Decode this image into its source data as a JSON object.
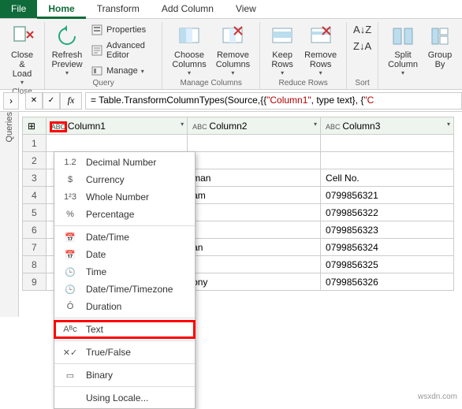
{
  "tabs": {
    "file": "File",
    "home": "Home",
    "transform": "Transform",
    "addcol": "Add Column",
    "view": "View"
  },
  "ribbon": {
    "close": {
      "close_load": "Close &\nLoad",
      "group": "Close"
    },
    "query": {
      "refresh": "Refresh\nPreview",
      "properties": "Properties",
      "advanced": "Advanced Editor",
      "manage": "Manage",
      "group": "Query"
    },
    "cols": {
      "choose": "Choose\nColumns",
      "remove": "Remove\nColumns",
      "group": "Manage Columns"
    },
    "rows": {
      "keep": "Keep\nRows",
      "remove": "Remove\nRows",
      "group": "Reduce Rows"
    },
    "sort": {
      "group": "Sort"
    },
    "cols2": {
      "split": "Split\nColumn",
      "groupby": "Group\nBy"
    }
  },
  "formula": {
    "prefix": "= Table.TransformColumnTypes(Source,{{",
    "s1": "\"Column1\"",
    "mid": ", type text}, {",
    "s2": "\"C"
  },
  "side": "Queries",
  "columns": {
    "c1": "Column1",
    "c2": "Column2",
    "c3": "Column3"
  },
  "rows_data": [
    {
      "n": "1",
      "c2": "",
      "c3": ""
    },
    {
      "n": "2",
      "c2": "",
      "c3": ""
    },
    {
      "n": "3",
      "c2": "man",
      "c3": "Cell No."
    },
    {
      "n": "4",
      "c2": "am",
      "c3": "0799856321"
    },
    {
      "n": "5",
      "c2": "",
      "c3": "0799856322"
    },
    {
      "n": "6",
      "c2": "",
      "c3": "0799856323"
    },
    {
      "n": "7",
      "c2": "an",
      "c3": "0799856324"
    },
    {
      "n": "8",
      "c2": "",
      "c3": "0799856325"
    },
    {
      "n": "9",
      "c2": "ony",
      "c3": "0799856326"
    }
  ],
  "menu": {
    "decimal": "Decimal Number",
    "currency": "Currency",
    "whole": "Whole Number",
    "percent": "Percentage",
    "datetime": "Date/Time",
    "date": "Date",
    "time": "Time",
    "dttz": "Date/Time/Timezone",
    "duration": "Duration",
    "text": "Text",
    "tf": "True/False",
    "binary": "Binary",
    "locale": "Using Locale..."
  },
  "typeicon": "ABC",
  "watermark": "wsxdn.com"
}
